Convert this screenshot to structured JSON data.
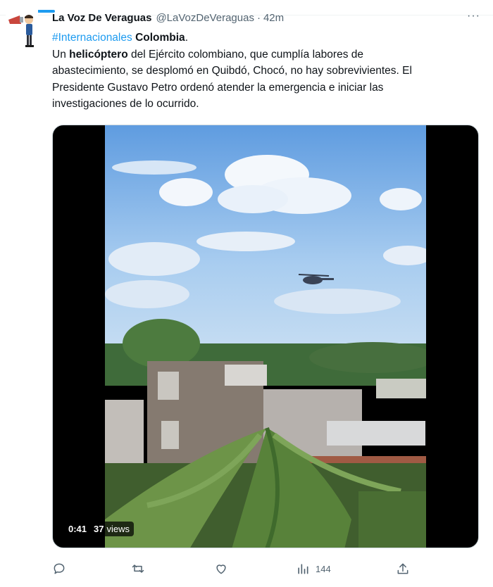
{
  "tweet": {
    "author_name": "La Voz De Veraguas",
    "author_handle": "@LaVozDeVeraguas",
    "separator": "·",
    "time": "42m",
    "more_label": "···",
    "hashtag": "#Internacionales",
    "country": "Colombia",
    "line1_pre": "Un",
    "line1_bold": "helicóptero",
    "line1_post": "del Ejército colombiano, que cumplía labores de",
    "line2": "abastecimiento, se desplomó en Quibdó, Chocó, no hay sobrevivientes. El",
    "line3": "Presidente Gustavo Petro ordenó atender la emergencia e iniciar las",
    "line4": "investigaciones de lo ocurrido."
  },
  "media": {
    "duration": "0:41",
    "views_count": "37",
    "views_label": "views"
  },
  "actions": {
    "reply_icon": "reply-icon",
    "retweet_icon": "retweet-icon",
    "like_icon": "like-icon",
    "analytics_icon": "analytics-icon",
    "analytics_count": "144",
    "share_icon": "share-icon"
  },
  "colors": {
    "accent": "#1d9bf0",
    "secondary_text": "#536471"
  }
}
